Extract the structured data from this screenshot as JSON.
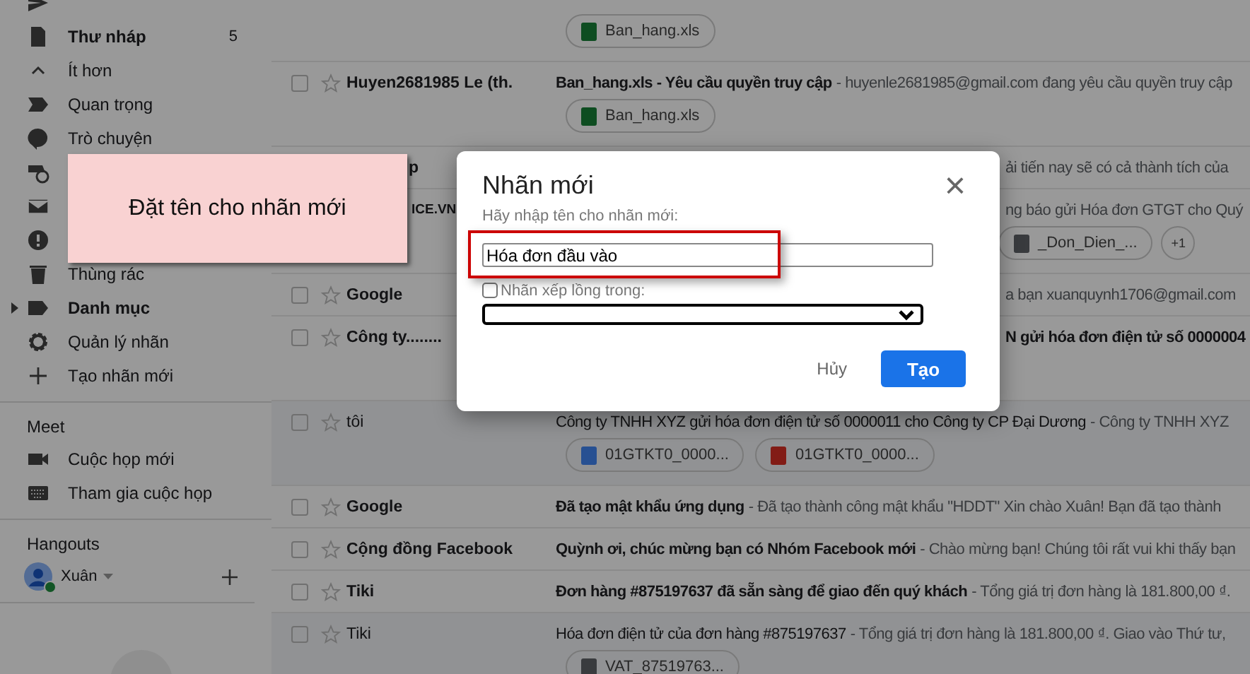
{
  "sidebar": {
    "items": [
      {
        "label": "Thư nháp",
        "bold": true,
        "count": "5"
      },
      {
        "label": "Ít hơn",
        "bold": false
      },
      {
        "label": "Quan trọng",
        "bold": false
      },
      {
        "label": "Trò chuyện",
        "bold": false
      },
      {
        "label": "Thùng rác",
        "bold": false
      },
      {
        "label": "Danh mục",
        "bold": true,
        "expandable": true
      },
      {
        "label": "Quản lý nhãn",
        "bold": false
      },
      {
        "label": "Tạo nhãn mới",
        "bold": false
      }
    ],
    "meet": {
      "title": "Meet",
      "items": [
        {
          "label": "Cuộc họp mới"
        },
        {
          "label": "Tham gia cuộc họp"
        }
      ]
    },
    "hangouts": {
      "title": "Hangouts",
      "user": "Xuân",
      "online": true
    }
  },
  "emails": [
    {
      "attachments": [
        {
          "kind": "xls",
          "name": "Ban_hang.xls"
        }
      ]
    },
    {
      "sender": "Huyen2681985 Le (th.",
      "checked": false,
      "starred": false,
      "unread": true,
      "subject": "Ban_hang.xls - Yêu cầu quyền truy cập",
      "snippet": "- huyenle2681985@gmail.com đang yêu cầu quyền truy cập",
      "attachments": [
        {
          "kind": "xls",
          "name": "Ban_hang.xls"
        }
      ]
    },
    {
      "sender": "p",
      "unread": true,
      "snippet": "ải tiến nay sẽ có cả thành tích của"
    },
    {
      "sender": "ICE.VN",
      "unread": true,
      "snippet": "ng báo gửi Hóa đơn GTGT cho Quý",
      "attachments": [
        {
          "kind": "file",
          "name": "_Don_Dien_..."
        },
        {
          "kind": "more",
          "name": "+1"
        }
      ]
    },
    {
      "sender": "Google",
      "checked": false,
      "starred": false,
      "unread": true,
      "snippet": "a bạn xuanquynh1706@gmail.com"
    },
    {
      "sender": "Công ty........",
      "checked": false,
      "starred": false,
      "unread": true,
      "subject": "N gửi hóa đơn điện tử số 0000004"
    },
    {
      "sender": "tôi",
      "checked": false,
      "starred": false,
      "unread": false,
      "subject": "Công ty TNHH XYZ gửi hóa đơn điện tử số 0000011 cho Công ty CP Đại Dương",
      "snippet": "- Công ty TNHH XYZ",
      "attachments": [
        {
          "kind": "doc",
          "name": "01GTKT0_0000..."
        },
        {
          "kind": "pdf",
          "name": "01GTKT0_0000..."
        }
      ]
    },
    {
      "sender": "Google",
      "checked": false,
      "starred": false,
      "unread": true,
      "subject": "Đã tạo mật khẩu ứng dụng",
      "snippet": "- Đã tạo thành công mật khẩu \"HDDT\" Xin chào Xuân! Bạn đã tạo thành"
    },
    {
      "sender": "Cộng đồng Facebook",
      "checked": false,
      "starred": false,
      "unread": true,
      "subject": "Quỳnh ơi, chúc mừng bạn có Nhóm Facebook mới",
      "snippet": "- Chào mừng bạn! Chúng tôi rất vui khi thấy bạn"
    },
    {
      "sender": "Tiki",
      "checked": false,
      "starred": false,
      "unread": true,
      "subject": "Đơn hàng #875197637 đã sẵn sàng để giao đến quý khách",
      "snippet": "- Tổng giá trị đơn hàng là 181.800,00 ₫."
    },
    {
      "sender": "Tiki",
      "checked": false,
      "starred": false,
      "unread": false,
      "subject": "Hóa đơn điện tử của đơn hàng #875197637",
      "snippet": "- Tổng giá trị đơn hàng là 181.800,00 ₫. Giao vào Thứ tư,",
      "attachments": [
        {
          "kind": "file",
          "name": "VAT_87519763..."
        }
      ]
    }
  ],
  "tooltip": {
    "text": "Đặt tên cho nhãn mới"
  },
  "dialog": {
    "title": "Nhãn mới",
    "close": "×",
    "name_label": "Hãy nhập tên cho nhãn mới:",
    "name_value": "Hóa đơn đầu vào",
    "nest_checked": false,
    "nest_label": "Nhãn xếp lồng trong:",
    "cancel": "Hủy",
    "create": "Tạo"
  }
}
